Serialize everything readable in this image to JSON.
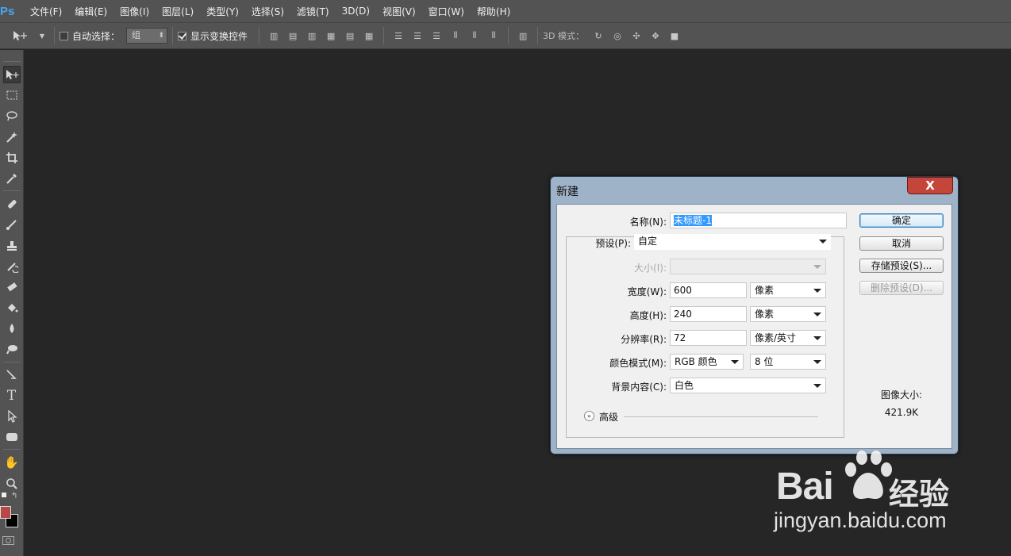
{
  "app": {
    "logo": "Ps"
  },
  "menu": [
    "文件(F)",
    "编辑(E)",
    "图像(I)",
    "图层(L)",
    "类型(Y)",
    "选择(S)",
    "滤镜(T)",
    "3D(D)",
    "视图(V)",
    "窗口(W)",
    "帮助(H)"
  ],
  "options": {
    "auto_select_label": "自动选择：",
    "auto_select_value": "组",
    "show_transform_label": "显示变换控件",
    "mode3d_label": "3D 模式：",
    "auto_select_checked": false,
    "show_transform_checked": true
  },
  "colors": {
    "foreground": "#b84848",
    "background": "#000000",
    "accent": "#3399ff"
  },
  "dialog": {
    "title": "新建",
    "close": "X",
    "name_label": "名称(N):",
    "name_value": "未标题-1",
    "preset_label": "预设(P):",
    "preset_value": "自定",
    "size_label": "大小(I):",
    "size_value": "",
    "width_label": "宽度(W):",
    "width_value": "600",
    "width_unit": "像素",
    "height_label": "高度(H):",
    "height_value": "240",
    "height_unit": "像素",
    "resolution_label": "分辨率(R):",
    "resolution_value": "72",
    "resolution_unit": "像素/英寸",
    "color_mode_label": "颜色模式(M):",
    "color_mode_value": "RGB 颜色",
    "bit_depth_value": "8 位",
    "background_label": "背景内容(C):",
    "background_value": "白色",
    "advanced_label": "高级",
    "ok": "确定",
    "cancel": "取消",
    "save_preset": "存储预设(S)...",
    "delete_preset": "删除预设(D)...",
    "image_size_label": "图像大小:",
    "image_size_value": "421.9K"
  },
  "watermark": {
    "brand": "Bai",
    "brand_cn": "经验",
    "url": "jingyan.baidu.com"
  }
}
